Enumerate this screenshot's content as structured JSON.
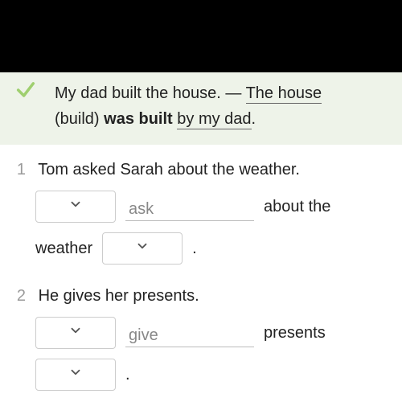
{
  "example": {
    "line1_prefix": "My dad built the house. — ",
    "line1_underlined": "The house",
    "line2_paren": "(build) ",
    "line2_bold": "was built ",
    "line2_underlined": "by my dad",
    "line2_period": "."
  },
  "questions": [
    {
      "number": "1",
      "prompt": "Tom asked Sarah about the weather.",
      "parts": [
        {
          "type": "dropdown"
        },
        {
          "type": "input",
          "value": "ask"
        },
        {
          "type": "text",
          "value": "about the"
        },
        {
          "type": "text",
          "value": "weather"
        },
        {
          "type": "dropdown"
        },
        {
          "type": "period",
          "value": "."
        }
      ]
    },
    {
      "number": "2",
      "prompt": "He gives her presents.",
      "parts": [
        {
          "type": "dropdown"
        },
        {
          "type": "input",
          "value": "give"
        },
        {
          "type": "text",
          "value": "presents"
        },
        {
          "type": "dropdown"
        },
        {
          "type": "period",
          "value": "."
        }
      ]
    }
  ]
}
